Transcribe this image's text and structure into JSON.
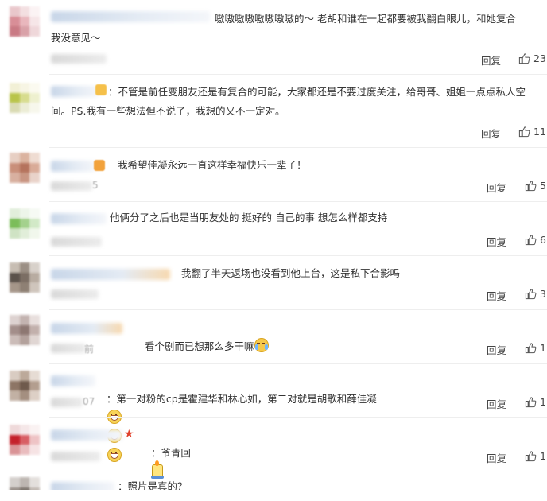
{
  "reply_label": "回复",
  "comments": [
    {
      "text_lines": [
        "嗷嗷嗷嗷嗷嗷嗷嗷的～ 老胡和谁在一起都要被我翻白眼儿，和她复合",
        "我没意见～"
      ],
      "likes": "23",
      "time_fragment": ""
    },
    {
      "text_lines": [
        "：不管是前任变朋友还是有复合的可能，大家都还是不要过度关注，给哥哥、姐姐一点点私人空",
        "间。PS.我有一些想法但不说了，我想的又不一定对。"
      ],
      "likes": "11",
      "time_fragment": ""
    },
    {
      "text_lines": [
        "我希望佳凝永远一直这样幸福快乐一辈子！"
      ],
      "likes": "5",
      "time_fragment": "5"
    },
    {
      "text_lines": [
        "他俩分了之后也是当朋友处的 挺好的 自己的事 想怎么样都支持"
      ],
      "likes": "6",
      "time_fragment": ""
    },
    {
      "text_lines": [
        "我翻了半天返场也没看到他上台，这是私下合影吗"
      ],
      "likes": "3",
      "time_fragment": ""
    },
    {
      "text_lines": [
        "看个剧而已想那么多干嘛"
      ],
      "likes": "1",
      "time_fragment": "前"
    },
    {
      "text_lines": [
        "：第一对粉的cp是霍建华和林心如，第二对就是胡歌和薛佳凝"
      ],
      "likes": "1",
      "time_fragment": "07"
    },
    {
      "text_lines": [
        "：爷青回"
      ],
      "likes": "1",
      "time_fragment": ""
    },
    {
      "text_lines": [
        "：照片是真的？"
      ],
      "likes": "",
      "time_fragment": ""
    }
  ],
  "colors": {
    "text": "#333333",
    "secondary": "#444444",
    "divider": "#eeeeee",
    "name_blur": "#c8d6e8"
  },
  "icons": {
    "like": "thumbs-up-icon",
    "emoji_grin": "grin-emoji-icon",
    "emoji_cry": "laugh-cry-emoji-icon",
    "emoji_candle": "candle-emoji-icon"
  }
}
